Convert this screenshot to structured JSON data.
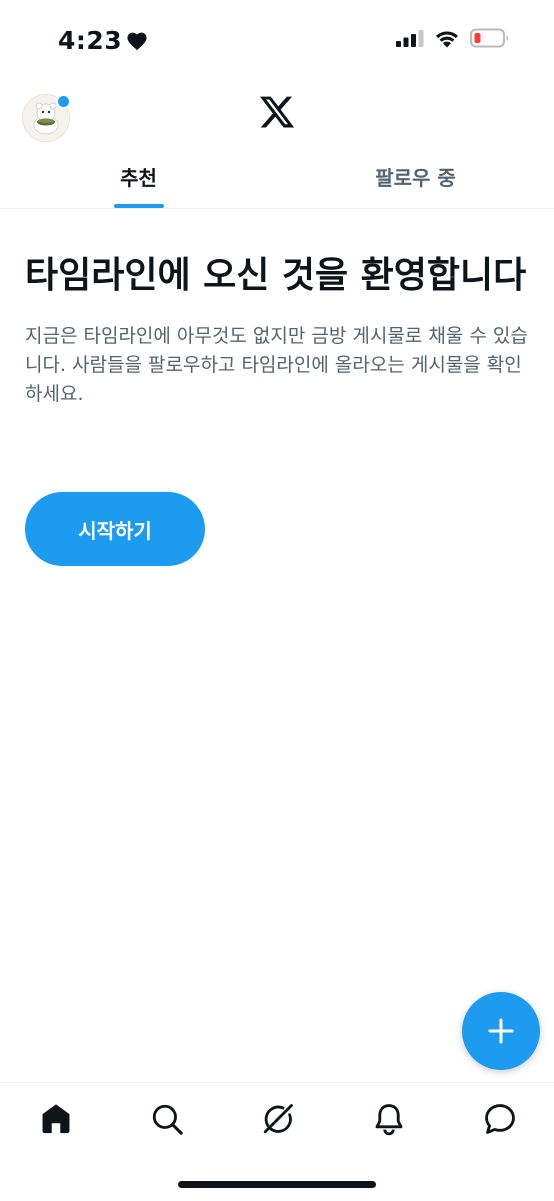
{
  "status_bar": {
    "time": "4:23",
    "heart_icon": "heart-icon",
    "signal_icon": "cellular-signal-icon",
    "wifi_icon": "wifi-icon",
    "battery_icon": "battery-low-icon",
    "battery_color": "#ff3b30"
  },
  "header": {
    "logo": "x-logo-icon",
    "has_notification_dot": true,
    "tabs": [
      {
        "label": "추천",
        "active": true
      },
      {
        "label": "팔로우 중",
        "active": false
      }
    ]
  },
  "main": {
    "title": "타임라인에 오신 것을 환영합니다",
    "body": "지금은 타임라인에 아무것도 없지만 금방 게시물로 채울 수 있습니다. 사람들을 팔로우하고 타임라인에 올라오는 게시물을 확인하세요.",
    "start_button_label": "시작하기"
  },
  "fab": {
    "icon": "plus-icon"
  },
  "bottom_nav": {
    "items": [
      {
        "icon": "home-icon",
        "active": true
      },
      {
        "icon": "search-icon",
        "active": false
      },
      {
        "icon": "grok-icon",
        "active": false
      },
      {
        "icon": "bell-icon",
        "active": false
      },
      {
        "icon": "message-icon",
        "active": false
      }
    ]
  },
  "colors": {
    "accent": "#1d9bf0",
    "text_primary": "#0f1419",
    "text_secondary": "#536471",
    "divider": "#eff3f4"
  }
}
